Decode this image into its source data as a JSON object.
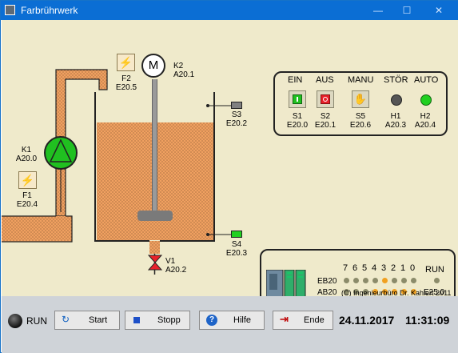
{
  "window": {
    "title": "Farbrührwerk",
    "minimize": "—",
    "maximize": "☐",
    "close": "✕"
  },
  "plant": {
    "k1": {
      "name": "K1",
      "addr": "A20.0"
    },
    "f1": {
      "name": "F1",
      "addr": "E20.4"
    },
    "f2": {
      "name": "F2",
      "addr": "E20.5"
    },
    "k2": {
      "name": "K2",
      "addr": "A20.1",
      "motor_symbol": "M"
    },
    "s3": {
      "name": "S3",
      "addr": "E20.2"
    },
    "s4": {
      "name": "S4",
      "addr": "E20.3"
    },
    "v1": {
      "name": "V1",
      "addr": "A20.2"
    },
    "colors": {
      "paint": "#f0a060",
      "pipe": "#e08a35",
      "pump": "#20c020",
      "valve": "#e8202a"
    }
  },
  "control_panel": {
    "headers": [
      "EIN",
      "AUS",
      "MANU",
      "STÖR",
      "AUTO"
    ],
    "items": [
      {
        "name": "S1",
        "addr": "E20.0",
        "icon": "power-on-icon"
      },
      {
        "name": "S2",
        "addr": "E20.1",
        "icon": "power-off-icon"
      },
      {
        "name": "S5",
        "addr": "E20.6",
        "icon": "hand-icon"
      },
      {
        "name": "H1",
        "addr": "A20.3",
        "icon": "lamp-gray-icon"
      },
      {
        "name": "H2",
        "addr": "A20.4",
        "icon": "lamp-green-icon"
      }
    ]
  },
  "io_panel": {
    "bits": [
      "7",
      "6",
      "5",
      "4",
      "3",
      "2",
      "1",
      "0"
    ],
    "run_label": "RUN",
    "eb_label": "EB20",
    "ab_label": "AB20",
    "eb_on": [
      false,
      false,
      false,
      false,
      true,
      false,
      false,
      false
    ],
    "ab_on": [
      false,
      false,
      false,
      true,
      true,
      true,
      true,
      true
    ],
    "run_addr": "E25.0"
  },
  "copyright": "(C) Ingenieurbüro Dr. Kahlert 2011",
  "statusbar": {
    "run_label": "RUN",
    "start_label": "Start",
    "stop_label": "Stopp",
    "help_label": "Hilfe",
    "end_label": "Ende",
    "date": "24.11.2017",
    "time": "11:31:09"
  }
}
